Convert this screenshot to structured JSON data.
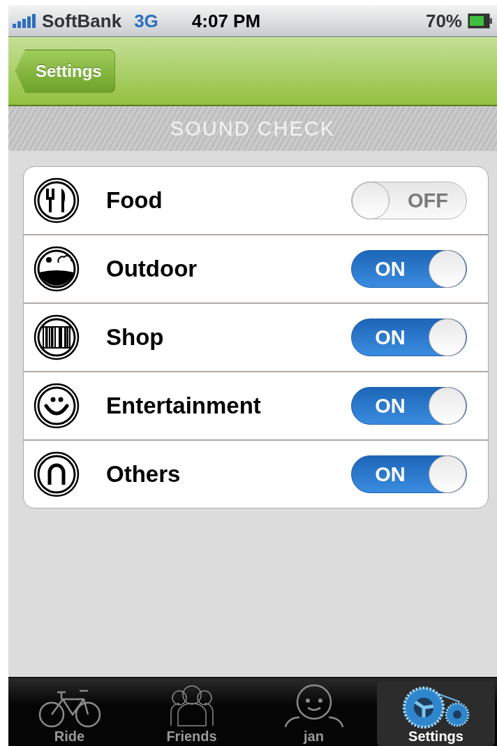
{
  "status_bar": {
    "carrier": "SoftBank",
    "network": "3G",
    "time": "4:07 PM",
    "battery": "70%"
  },
  "nav_bar": {
    "back_button": "Settings"
  },
  "section_header": "SOUND CHECK",
  "categories": [
    {
      "kind": "food",
      "label": "Food",
      "on": false,
      "switch_text": "OFF"
    },
    {
      "kind": "outdoor",
      "label": "Outdoor",
      "on": true,
      "switch_text": "ON"
    },
    {
      "kind": "shop",
      "label": "Shop",
      "on": true,
      "switch_text": "ON"
    },
    {
      "kind": "entertainment",
      "label": "Entertainment",
      "on": true,
      "switch_text": "ON"
    },
    {
      "kind": "others",
      "label": "Others",
      "on": true,
      "switch_text": "ON"
    }
  ],
  "tab_bar": [
    {
      "kind": "ride",
      "label": "Ride",
      "selected": false
    },
    {
      "kind": "friends",
      "label": "Friends",
      "selected": false
    },
    {
      "kind": "profile",
      "label": "jan",
      "selected": false
    },
    {
      "kind": "settings",
      "label": "Settings",
      "selected": true
    }
  ]
}
